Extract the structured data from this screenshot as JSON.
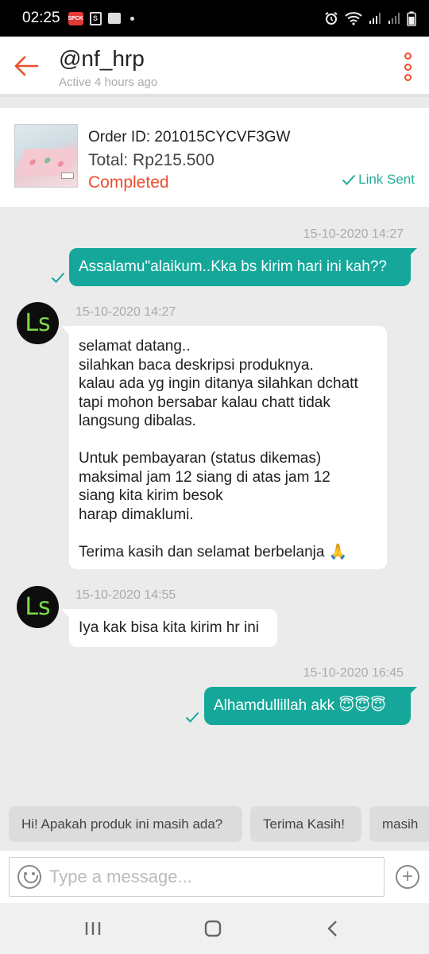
{
  "status_bar": {
    "time": "02:25",
    "notif_app_label": "SPCK",
    "bag_label": "S"
  },
  "header": {
    "title": "@nf_hrp",
    "subtitle": "Active 4 hours ago",
    "accent_color": "#ee4d2d"
  },
  "order": {
    "id_label": "Order ID: 201015CYCVF3GW",
    "total_label": "Total: Rp215.500",
    "status": "Completed",
    "link_status": "Link Sent"
  },
  "contact": {
    "avatar_text": "Ls"
  },
  "messages": [
    {
      "direction": "out",
      "timestamp": "15-10-2020 14:27",
      "lines": [
        "Assalamu\"alaikum..Kka bs kirim hari ini kah??"
      ]
    },
    {
      "direction": "in",
      "timestamp": "15-10-2020 14:27",
      "lines": [
        "selamat datang..",
        "silahkan baca deskripsi produknya.",
        "kalau ada yg ingin ditanya silahkan dchatt",
        "tapi mohon bersabar kalau chatt tidak",
        "langsung dibalas.",
        "",
        "Untuk pembayaran (status dikemas)",
        "maksimal jam 12 siang di atas jam 12",
        "siang kita kirim besok",
        "harap dimaklumi.",
        "",
        "Terima kasih dan selamat berbelanja 🙏"
      ]
    },
    {
      "direction": "in",
      "timestamp": "15-10-2020 14:55",
      "lines": [
        "Iya kak bisa kita kirim hr ini"
      ]
    },
    {
      "direction": "out",
      "timestamp": "15-10-2020 16:45",
      "lines": [
        "Alhamdullillah akk 😇😇😇"
      ]
    }
  ],
  "quick_replies": [
    "Hi! Apakah produk ini masih ada?",
    "Terima Kasih!",
    "masih"
  ],
  "composer": {
    "placeholder": "Type a message..."
  },
  "colors": {
    "accent": "#ee4d2d",
    "outgoing_bubble": "#15a89a",
    "link_sent": "#26aa99",
    "chat_background": "#ebebeb"
  },
  "icons": {
    "back": "arrow-left-icon",
    "more": "more-vertical-icon",
    "check": "check-icon",
    "emoji": "smiley-icon",
    "add": "plus-circle-icon",
    "nav_recents": "recents-icon",
    "nav_home": "home-icon",
    "nav_back": "back-chevron-icon"
  }
}
